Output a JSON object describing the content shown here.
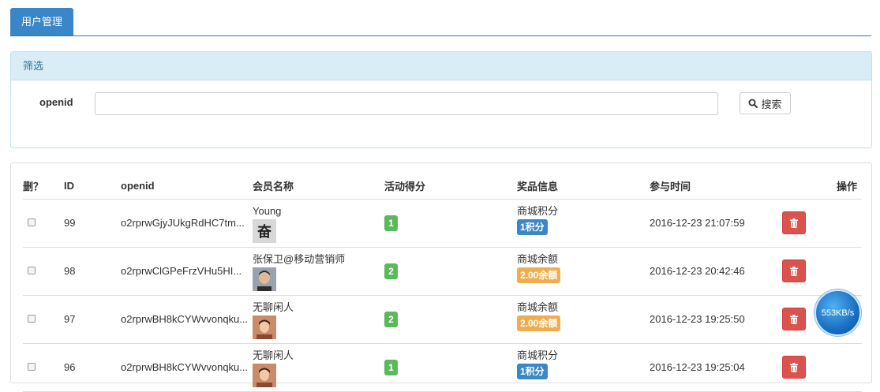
{
  "tab": {
    "label": "用户管理"
  },
  "filter": {
    "heading": "筛选",
    "openid_label": "openid",
    "openid_value": "",
    "search_label": "搜索"
  },
  "table": {
    "columns": [
      "删？",
      "ID",
      "openid",
      "会员名称",
      "活动得分",
      "奖品信息",
      "参与时间",
      "操作"
    ],
    "rows": [
      {
        "id": "99",
        "openid": "o2rprwGjyJUkgRdHC7tm...",
        "name": "Young",
        "score": "1",
        "prize_type": "商城积分",
        "prize_value": "1积分",
        "prize_color": "#3a87c8",
        "time": "2016-12-23 21:07:59"
      },
      {
        "id": "98",
        "openid": "o2rprwClGPeFrzVHu5HI...",
        "name": "张保卫@移动营销师",
        "score": "2",
        "prize_type": "商城余额",
        "prize_value": "2.00余额",
        "prize_color": "#f0ad4e",
        "time": "2016-12-23 20:42:46"
      },
      {
        "id": "97",
        "openid": "o2rprwBH8kCYWvvonqku...",
        "name": "无聊闲人",
        "score": "2",
        "prize_type": "商城余额",
        "prize_value": "2.00余额",
        "prize_color": "#f0ad4e",
        "time": "2016-12-23 19:25:50"
      },
      {
        "id": "96",
        "openid": "o2rprwBH8kCYWvvonqku...",
        "name": "无聊闲人",
        "score": "1",
        "prize_type": "商城积分",
        "prize_value": "1积分",
        "prize_color": "#3a87c8",
        "time": "2016-12-23 19:25:04"
      }
    ]
  },
  "speed_widget": {
    "label": "553KB/s"
  }
}
